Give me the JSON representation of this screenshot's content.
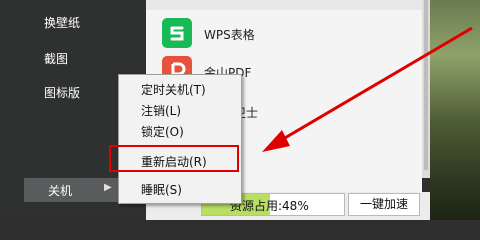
{
  "left_panel": {
    "items": [
      {
        "label": "换壁纸"
      },
      {
        "label": "截图"
      },
      {
        "label": "图标版"
      }
    ],
    "power": {
      "label": "关机",
      "arrow": "▶"
    }
  },
  "app_list": {
    "apps": [
      {
        "label": "WPS表格",
        "icon": "wps-spreadsheet-icon",
        "color": "#19b955"
      },
      {
        "label": "金山PDF",
        "icon": "kingsoft-pdf-icon",
        "color": "#e5533d"
      },
      {
        "label": "全卫士",
        "icon": "security-guard-icon",
        "color": "#ffffff"
      }
    ]
  },
  "context_menu": {
    "items": [
      {
        "label": "定时关机(T)"
      },
      {
        "label": "注销(L)"
      },
      {
        "label": "锁定(O)"
      },
      {
        "label": "重新启动(R)"
      },
      {
        "label": "睡眠(S)"
      }
    ]
  },
  "bottom_bar": {
    "resource_label": "资源占用:48%",
    "resource_percent": 48,
    "boost_label": "一键加速"
  },
  "colors": {
    "accent_green": "#b8de64",
    "annotation_red": "#e00000"
  }
}
